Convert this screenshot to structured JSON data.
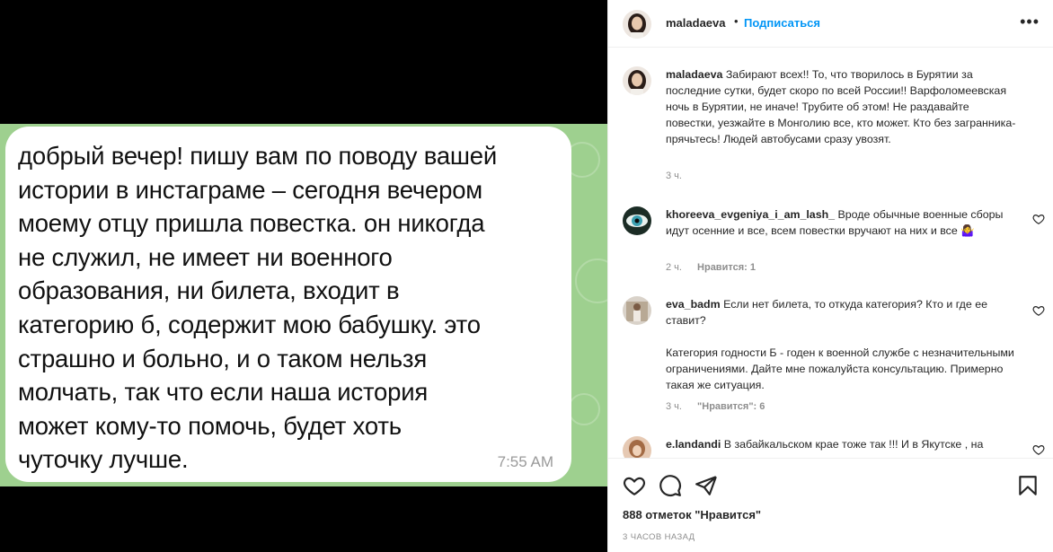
{
  "post": {
    "message_text": "добрый вечер! пишу вам по поводу вашей\nистории в инстаграме – сегодня вечером\nмоему отцу пришла повестка. он никогда\nне служил, не имеет ни военного\nобразования, ни билета, входит в\nкатегорию б, содержит мою бабушку. это\nстрашно и больно, и о таком нельзя\nмолчать, так что если наша история\nможет кому-то помочь, будет хоть\nчуточку лучше.",
    "message_time": "7:55 AM"
  },
  "header": {
    "username": "maladaeva",
    "separator": "•",
    "follow_label": "Подписаться",
    "more_label": "•••"
  },
  "comments": [
    {
      "username": "maladaeva",
      "text": "Забирают всех!! То, что творилось в Бурятии за последние сутки, будет скоро по всей России!! Варфоломеевская ночь в Бурятии, не иначе! Трубите об этом! Не раздавайте повестки, уезжайте в Монголию все, кто может. Кто без загранника- прячьтесь! Людей автобусами сразу увозят.",
      "time": "3 ч."
    },
    {
      "username": "khoreeva_evgeniya_i_am_lash_",
      "text": "Вроде обычные военные сборы идут осенние и все, всем повестки вручают на них и все 🤷‍♀️",
      "time": "2 ч.",
      "likes": "Нравится: 1"
    },
    {
      "username": "eva_badm",
      "text": "Если нет билета, то откуда категория? Кто и где ее ставит?",
      "text2": "Категория годности Б - годен к военной службе с незначительными ограничениями. Дайте мне пожалуйста консультацию. Примерно такая же ситуация.",
      "time": "3 ч.",
      "likes": "\"Нравится\": 6"
    },
    {
      "username": "e.landandi",
      "text": "В забайкальском крае тоже так !!! И в Якутске , на"
    }
  ],
  "footer": {
    "likes": "888 отметок \"Нравится\"",
    "time_ago": "3 часов назад"
  },
  "icons": [
    "heart-icon",
    "comment-icon",
    "share-icon",
    "bookmark-icon",
    "more-icon"
  ],
  "colors": {
    "accent": "#0095f6",
    "media_bg": "#9ed08f",
    "text": "#262626",
    "muted": "#8e8e8e"
  }
}
